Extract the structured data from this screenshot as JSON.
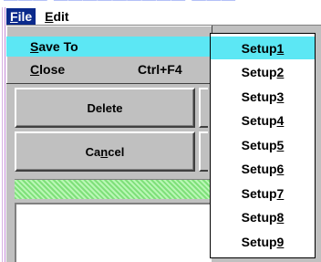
{
  "menubar": {
    "items": [
      {
        "label_pre": "",
        "label_mn": "F",
        "label_post": "ile"
      },
      {
        "label_pre": "",
        "label_mn": "E",
        "label_post": "dit"
      }
    ]
  },
  "file_menu": {
    "items": [
      {
        "label_pre": "",
        "label_mn": "S",
        "label_post": "ave To",
        "accelerator": ""
      },
      {
        "label_pre": "",
        "label_mn": "C",
        "label_post": "lose",
        "accelerator": "Ctrl+F4"
      }
    ]
  },
  "submenu": {
    "items": [
      {
        "label": "Setup ",
        "num": "1"
      },
      {
        "label": "Setup ",
        "num": "2"
      },
      {
        "label": "Setup ",
        "num": "3"
      },
      {
        "label": "Setup ",
        "num": "4"
      },
      {
        "label": "Setup ",
        "num": "5"
      },
      {
        "label": "Setup ",
        "num": "6"
      },
      {
        "label": "Setup ",
        "num": "7"
      },
      {
        "label": "Setup ",
        "num": "8"
      },
      {
        "label": "Setup ",
        "num": "9"
      }
    ]
  },
  "buttons": {
    "delete": {
      "label": "Delete"
    },
    "cancel": {
      "pre": "Ca",
      "mn": "n",
      "post": "cel"
    }
  },
  "colors": {
    "highlight": "#5ce7f4",
    "menubar_active": "#0b2a8c",
    "progress_fill": "#9ff09b",
    "window_face": "#c0c0c0"
  }
}
